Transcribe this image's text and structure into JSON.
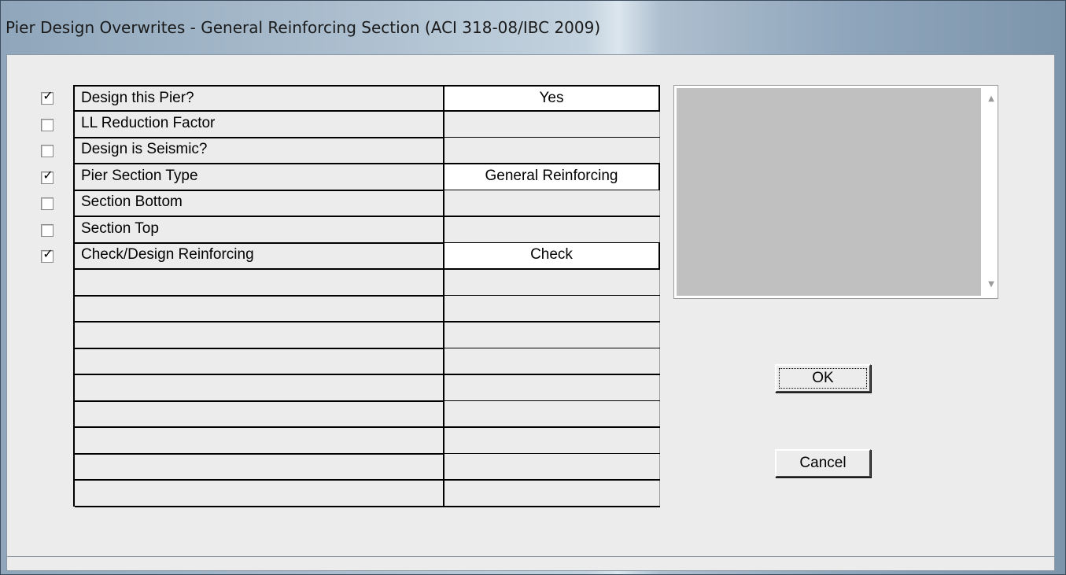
{
  "window": {
    "title": "Pier Design Overwrites - General Reinforcing Section (ACI 318-08/IBC 2009)"
  },
  "rows": [
    {
      "checked": true,
      "label": "Design this Pier?",
      "value": "Yes",
      "active": true
    },
    {
      "checked": false,
      "label": "LL Reduction Factor",
      "value": "",
      "active": false
    },
    {
      "checked": false,
      "label": "Design is Seismic?",
      "value": "",
      "active": false
    },
    {
      "checked": true,
      "label": "Pier Section Type",
      "value": "General Reinforcing",
      "active": true
    },
    {
      "checked": false,
      "label": "Section Bottom",
      "value": "",
      "active": false
    },
    {
      "checked": false,
      "label": "Section Top",
      "value": "",
      "active": false
    },
    {
      "checked": true,
      "label": "Check/Design Reinforcing",
      "value": "Check",
      "active": true
    },
    {
      "label": "",
      "value": ""
    },
    {
      "label": "",
      "value": ""
    },
    {
      "label": "",
      "value": ""
    },
    {
      "label": "",
      "value": ""
    },
    {
      "label": "",
      "value": ""
    },
    {
      "label": "",
      "value": ""
    },
    {
      "label": "",
      "value": ""
    },
    {
      "label": "",
      "value": ""
    },
    {
      "label": "",
      "value": ""
    }
  ],
  "buttons": {
    "ok": "OK",
    "cancel": "Cancel"
  }
}
